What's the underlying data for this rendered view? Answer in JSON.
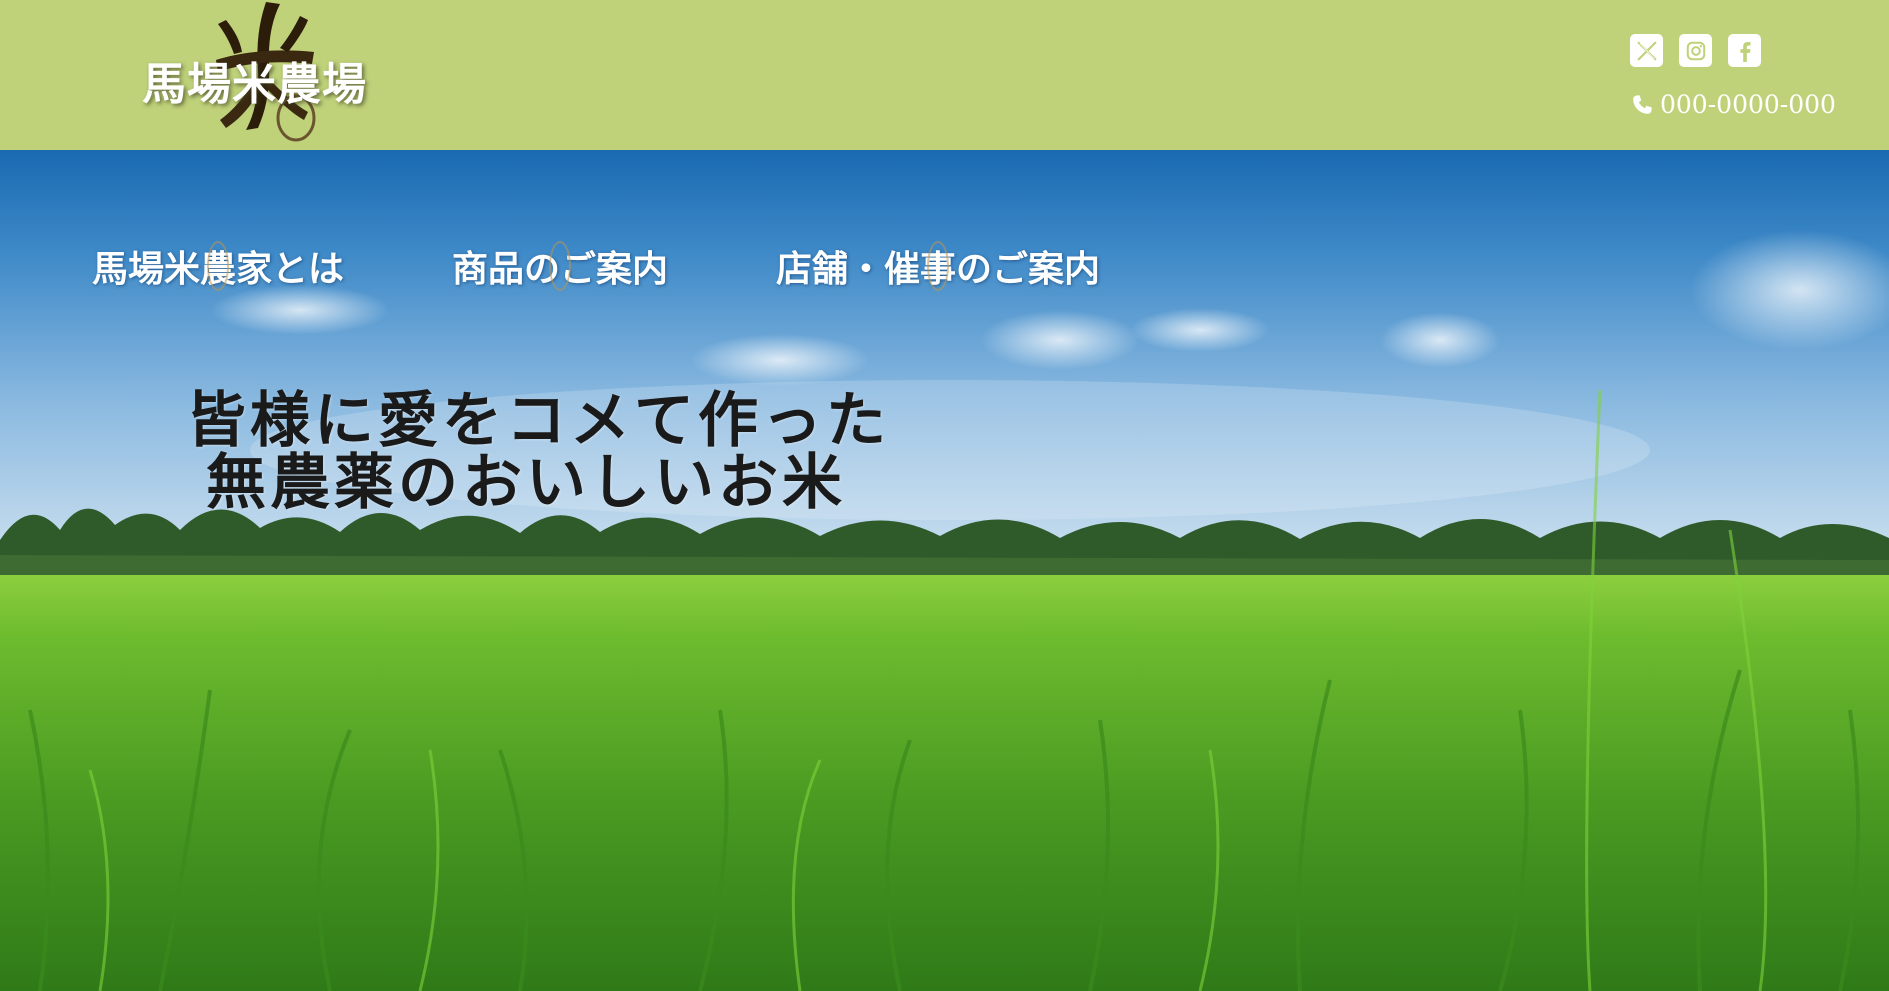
{
  "header": {
    "logo_text": "馬場米農場",
    "phone": "000-0000-000",
    "social": [
      {
        "icon": "x-icon"
      },
      {
        "icon": "instagram-icon"
      },
      {
        "icon": "facebook-icon"
      }
    ]
  },
  "nav": {
    "items": [
      {
        "label": "馬場米農家とは"
      },
      {
        "label": "商品のご案内"
      },
      {
        "label": "店舗・催事のご案内"
      }
    ]
  },
  "hero": {
    "headline_line1": "皆様に愛をコメて作った",
    "headline_line2": "無農薬のおいしいお米"
  },
  "colors": {
    "header_bg": "#bfd27a",
    "sky_top": "#1f6fb5",
    "field_green": "#5aa62c"
  }
}
